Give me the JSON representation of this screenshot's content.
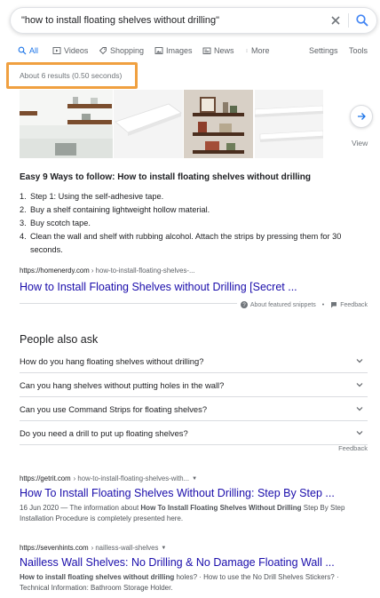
{
  "search": {
    "query": "\"how to install floating shelves without drilling\""
  },
  "tabs": [
    {
      "label": "All",
      "icon": "search-icon"
    },
    {
      "label": "Videos",
      "icon": "video-icon"
    },
    {
      "label": "Shopping",
      "icon": "tag-icon"
    },
    {
      "label": "Images",
      "icon": "image-icon"
    },
    {
      "label": "News",
      "icon": "newspaper-icon"
    },
    {
      "label": "More",
      "icon": "kebab-icon"
    },
    {
      "label": "Settings"
    },
    {
      "label": "Tools"
    }
  ],
  "stats": "About 6 results (0.50 seconds)",
  "images": {
    "view_label": "View"
  },
  "snippet": {
    "heading": "Easy 9 Ways to follow: How to install floating shelves without drilling",
    "steps": [
      {
        "num": "1.",
        "text": "Step 1: Using the self-adhesive tape."
      },
      {
        "num": "2.",
        "text": "Buy a shelf containing lightweight hollow material."
      },
      {
        "num": "3.",
        "text": "Buy scotch tape."
      },
      {
        "num": "4.",
        "text": "Clean the wall and shelf with rubbing alcohol. Attach the strips by pressing them for 30 seconds."
      }
    ],
    "url_domain": "https://homenerdy.com",
    "url_path": " › how-to-install-floating-shelves-...",
    "title": "How to Install Floating Shelves without Drilling [Secret ...",
    "about_label": "About featured snippets",
    "feedback_label": "Feedback"
  },
  "paa": {
    "title": "People also ask",
    "questions": [
      "How do you hang floating shelves without drilling?",
      "Can you hang shelves without putting holes in the wall?",
      "Can you use Command Strips for floating shelves?",
      "Do you need a drill to put up floating shelves?"
    ],
    "feedback_label": "Feedback"
  },
  "results": [
    {
      "url_domain": "https://getrit.com",
      "url_path": " › how-to-install-floating-shelves-with...",
      "title": "How To Install Floating Shelves Without Drilling: Step By Step ...",
      "date": "16 Jun 2020",
      "snippet_pre": " — The information about ",
      "snippet_bold": "How To Install Floating Shelves Without Drilling",
      "snippet_post": " Step By Step Installation Procedure is completely presented here."
    },
    {
      "url_domain": "https://sevenhints.com",
      "url_path": " › nailless-wall-shelves",
      "title": "Nailless Wall Shelves: No Drilling & No Damage Floating Wall ...",
      "snippet_bold": "How to install floating shelves without drilling",
      "snippet_post": " holes? · How to use the No Drill Shelves Stickers? · Technical Information: Bathroom Storage Holder."
    }
  ],
  "colors": {
    "link": "#1a0dab",
    "accent": "#1a73e8",
    "highlight": "#f0a040"
  }
}
